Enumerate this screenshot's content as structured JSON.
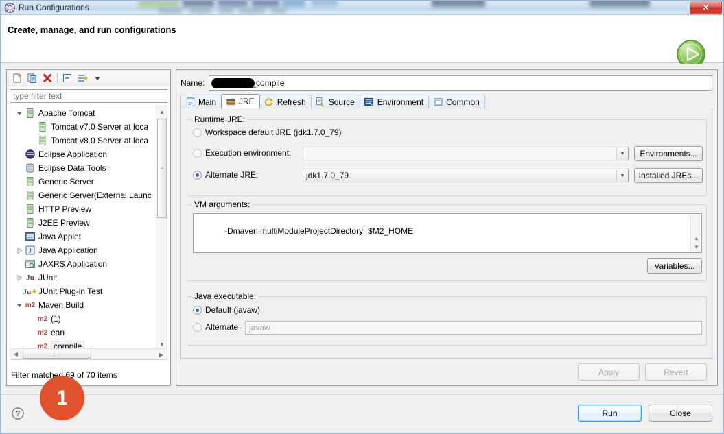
{
  "window": {
    "title": "Run Configurations",
    "title_icon": "run-configurations-icon",
    "close_glyph": "✕"
  },
  "header": {
    "title": "Create, manage, and run configurations",
    "run_icon": "green-run-play-icon"
  },
  "left_panel": {
    "toolbar": [
      {
        "name": "new-launch-configuration-icon",
        "label": "New"
      },
      {
        "name": "duplicate-launch-configuration-icon",
        "label": "Duplicate"
      },
      {
        "name": "delete-launch-configuration-icon",
        "label": "Delete"
      },
      {
        "name": "collapse-all-icon",
        "label": "Collapse All"
      },
      {
        "name": "filter-launch-configurations-icon",
        "label": "Filter"
      },
      {
        "name": "chevron-down-icon",
        "label": "Menu"
      }
    ],
    "filter_placeholder": "type filter text",
    "filter_value": "",
    "status": "Filter matched 69 of 70 items",
    "tree": [
      {
        "label": "Apache Tomcat",
        "icon": "server-icon",
        "indent": 0,
        "twisty": "expanded"
      },
      {
        "label": "Tomcat v7.0 Server at loca",
        "icon": "server-icon",
        "indent": 1,
        "twisty": "none"
      },
      {
        "label": "Tomcat v8.0 Server at loca",
        "icon": "server-icon",
        "indent": 1,
        "twisty": "none"
      },
      {
        "label": "Eclipse Application",
        "icon": "eclipse-icon",
        "indent": 0,
        "twisty": "none"
      },
      {
        "label": "Eclipse Data Tools",
        "icon": "database-icon",
        "indent": 0,
        "twisty": "none"
      },
      {
        "label": "Generic Server",
        "icon": "server-icon",
        "indent": 0,
        "twisty": "none"
      },
      {
        "label": "Generic Server(External Launc",
        "icon": "server-icon",
        "indent": 0,
        "twisty": "none"
      },
      {
        "label": "HTTP Preview",
        "icon": "server-icon",
        "indent": 0,
        "twisty": "none"
      },
      {
        "label": "J2EE Preview",
        "icon": "server-icon",
        "indent": 0,
        "twisty": "none"
      },
      {
        "label": "Java Applet",
        "icon": "java-applet-icon",
        "indent": 0,
        "twisty": "none"
      },
      {
        "label": "Java Application",
        "icon": "java-application-icon",
        "indent": 0,
        "twisty": "collapsed"
      },
      {
        "label": "JAXRS Application",
        "icon": "jaxrs-icon",
        "indent": 0,
        "twisty": "none"
      },
      {
        "label": "JUnit",
        "icon": "junit-icon",
        "indent": 0,
        "twisty": "collapsed"
      },
      {
        "label": "JUnit Plug-in Test",
        "icon": "junit-plugin-icon",
        "indent": 0,
        "twisty": "none"
      },
      {
        "label": "Maven Build",
        "icon": "maven-icon",
        "indent": 0,
        "twisty": "expanded"
      },
      {
        "label": "(1)",
        "icon": "maven-icon",
        "indent": 1,
        "twisty": "none"
      },
      {
        "label": "ean",
        "icon": "maven-icon",
        "indent": 1,
        "twisty": "none"
      },
      {
        "label": "compile",
        "icon": "maven-icon",
        "indent": 1,
        "twisty": "none",
        "selected": true
      }
    ]
  },
  "annotation": {
    "badge_1": "1"
  },
  "right_panel": {
    "name_label": "Name:",
    "name_value": "_compile",
    "tabs": [
      {
        "label": "Main",
        "icon": "main-tab-icon",
        "active": false
      },
      {
        "label": "JRE",
        "icon": "jre-tab-icon",
        "active": true
      },
      {
        "label": "Refresh",
        "icon": "refresh-tab-icon",
        "active": false
      },
      {
        "label": "Source",
        "icon": "source-tab-icon",
        "active": false
      },
      {
        "label": "Environment",
        "icon": "environment-tab-icon",
        "active": false
      },
      {
        "label": "Common",
        "icon": "common-tab-icon",
        "active": false
      }
    ],
    "runtime_jre": {
      "group_title": "Runtime JRE:",
      "workspace_default": {
        "label": "Workspace default JRE (jdk1.7.0_79)",
        "selected": false
      },
      "execution_environment": {
        "label": "Execution environment:",
        "selected": false,
        "value": "",
        "button": "Environments..."
      },
      "alternate_jre": {
        "label": "Alternate JRE:",
        "selected": true,
        "value": "jdk1.7.0_79",
        "button": "Installed JREs..."
      }
    },
    "vm_arguments": {
      "group_title": "VM arguments:",
      "value": "-Dmaven.multiModuleProjectDirectory=$M2_HOME",
      "variables_button": "Variables..."
    },
    "java_executable": {
      "group_title": "Java executable:",
      "default": {
        "label": "Default (javaw)",
        "selected": true
      },
      "alternate": {
        "label": "Alternate",
        "selected": false,
        "placeholder": "javaw",
        "value": ""
      }
    },
    "apply_button": "Apply",
    "revert_button": "Revert"
  },
  "footer": {
    "help_icon": "help-question-icon",
    "run_button": "Run",
    "close_button": "Close"
  },
  "colors": {
    "accent_blue": "#3c9ad4",
    "annotation_orange": "#e0522d",
    "close_red": "#c9302c",
    "maven_red": "#c0392b",
    "run_green": "#6fbf3f"
  }
}
